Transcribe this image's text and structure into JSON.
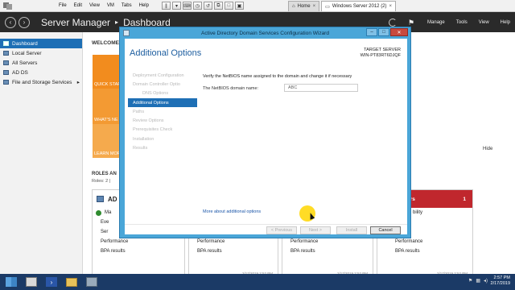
{
  "vm_menu": [
    "File",
    "Edit",
    "View",
    "VM",
    "Tabs",
    "Help"
  ],
  "vm_tabs": [
    {
      "label": "Home",
      "active": false
    },
    {
      "label": "Windows Server 2012 (2)",
      "active": true
    }
  ],
  "header": {
    "app": "Server Manager",
    "page": "Dashboard",
    "menu": [
      "Manage",
      "Tools",
      "View",
      "Help"
    ]
  },
  "sidebar": {
    "items": [
      {
        "label": "Dashboard",
        "active": true
      },
      {
        "label": "Local Server",
        "active": false
      },
      {
        "label": "All Servers",
        "active": false
      },
      {
        "label": "AD DS",
        "active": false
      },
      {
        "label": "File and Storage Services",
        "active": false
      }
    ]
  },
  "dashboard": {
    "welcome": "WELCOME",
    "tiles": [
      "QUICK STAR",
      "WHAT'S NE",
      "LEARN MOR"
    ],
    "hide": "Hide",
    "roles_label": "ROLES AN",
    "roles_count": "Roles: 2 |",
    "cards": [
      {
        "title": "AD",
        "rows": [
          "Ma",
          "Eve",
          "Ser",
          "Performance",
          "BPA results"
        ],
        "date": ""
      },
      {
        "title": "",
        "rows": [
          "Performance",
          "BPA results"
        ],
        "date": "2/17/2019 2:52 PM"
      },
      {
        "title": "",
        "rows": [
          "Performance",
          "BPA results"
        ],
        "date": "2/17/2019 2:52 PM"
      },
      {
        "title": "rvers",
        "badge": "1",
        "rows": [
          "bility",
          "",
          "",
          "Performance",
          "BPA results"
        ],
        "date": "2/17/2019 2:52 PM"
      }
    ]
  },
  "wizard": {
    "title": "Active Directory Domain Services Configuration Wizard",
    "heading": "Additional Options",
    "target_label": "TARGET SERVER",
    "target_name": "WIN-PT83RT6DJQF",
    "steps": [
      {
        "label": "Deployment Configuration",
        "active": false,
        "sub": false
      },
      {
        "label": "Domain Controller Optio",
        "active": false,
        "sub": false
      },
      {
        "label": "DNS Options",
        "active": false,
        "sub": true
      },
      {
        "label": "Additional Options",
        "active": true,
        "sub": false
      },
      {
        "label": "Paths",
        "active": false,
        "sub": false
      },
      {
        "label": "Review Options",
        "active": false,
        "sub": false
      },
      {
        "label": "Prerequisites Check",
        "active": false,
        "sub": false
      },
      {
        "label": "Installation",
        "active": false,
        "sub": false
      },
      {
        "label": "Results",
        "active": false,
        "sub": false
      }
    ],
    "description": "Verify the NetBIOS name assigned to the domain and change it if necessary",
    "netbios_label": "The NetBIOS domain name:",
    "netbios_value": "ABC",
    "more_link": "More about additional options",
    "buttons": {
      "previous": "< Previous",
      "next": "Next >",
      "install": "Install",
      "cancel": "Cancel"
    }
  },
  "taskbar": {
    "time": "2:57 PM",
    "date": "2/17/2019"
  },
  "colors": {
    "accent": "#1e6fb5",
    "wizard_frame": "#4aa6d8",
    "header_bg": "#2a2a2a",
    "tile_orange": "#f28c1e",
    "alert_red": "#c0272d"
  }
}
